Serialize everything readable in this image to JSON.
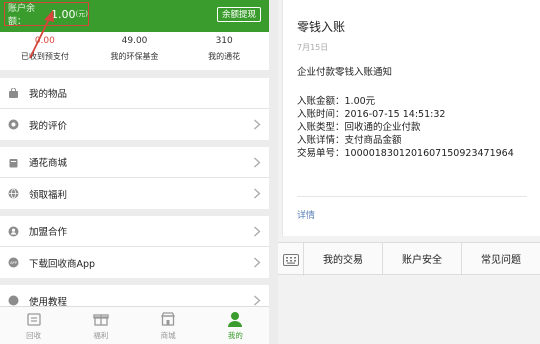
{
  "left": {
    "balance_label": "账户余额：",
    "balance_value": "1.00",
    "balance_unit": "(元)",
    "withdraw_label": "余额提现",
    "stats": [
      {
        "value": "0.00",
        "label": "已收到预支付"
      },
      {
        "value": "49.00",
        "label": "我的环保基金"
      },
      {
        "value": "310",
        "label": "我的通花"
      }
    ],
    "menu": [
      {
        "label": "我的物品"
      },
      {
        "label": "我的评价"
      },
      {
        "label": "通花商城"
      },
      {
        "label": "领取福利"
      },
      {
        "label": "加盟合作"
      },
      {
        "label": "下载回收商App"
      },
      {
        "label": "使用教程"
      }
    ],
    "tabs": [
      {
        "label": "回收"
      },
      {
        "label": "福利"
      },
      {
        "label": "商城"
      },
      {
        "label": "我的"
      }
    ],
    "accent_color": "#3a9c2c",
    "highlight_color": "#d6453c"
  },
  "right": {
    "title": "零钱入账",
    "date": "7月15日",
    "heading": "企业付款零钱入账通知",
    "details": [
      {
        "label": "入账金额：",
        "value": "1.00元"
      },
      {
        "label": "入账时间：",
        "value": "2016-07-15 14:51:32"
      },
      {
        "label": "入账类型：",
        "value": "回收通的企业付款"
      },
      {
        "label": "入账详情：",
        "value": "支付商品金额"
      },
      {
        "label": "交易单号：",
        "value": "1000018301201607150923471964"
      }
    ],
    "link": "详情",
    "menus": [
      "我的交易",
      "账户安全",
      "常见问题"
    ]
  }
}
